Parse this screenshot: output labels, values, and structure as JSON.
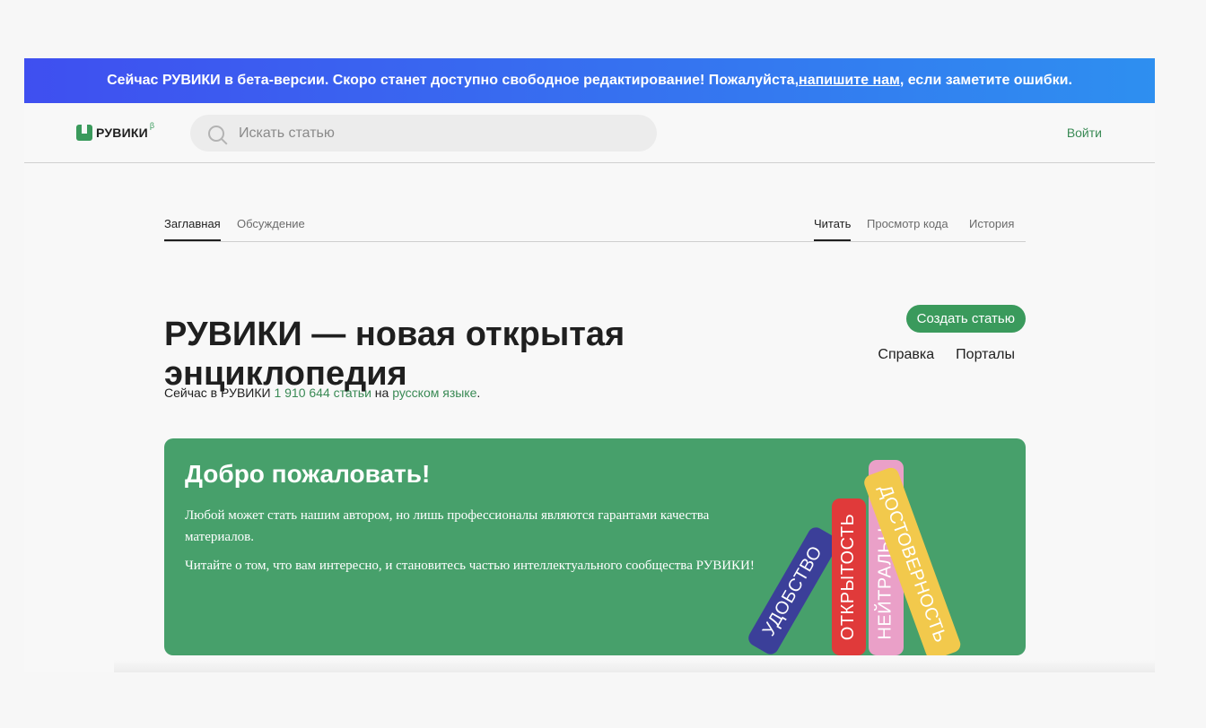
{
  "banner": {
    "text_before": "Сейчас РУВИКИ в бета-версии. Скоро станет доступно свободное редактирование! Пожалуйста, ",
    "link": "напишите нам",
    "text_after": ", если заметите ошибки."
  },
  "header": {
    "logo_text": "РУВИКИ",
    "logo_sup": "β",
    "search_placeholder": "Искать статью",
    "login": "Войти"
  },
  "tabs": {
    "left": [
      "Заглавная",
      "Обсуждение"
    ],
    "right": [
      "Читать",
      "Просмотр кода",
      "История"
    ]
  },
  "main": {
    "title": "РУВИКИ — новая открытая энциклопедия",
    "create_button": "Создать статью",
    "help_link": "Справка",
    "portals_link": "Порталы",
    "stats_prefix": "Сейчас в РУВИКИ ",
    "stats_count": "1 910 644 статьи",
    "stats_mid": " на ",
    "stats_lang": "русском языке",
    "stats_suffix": "."
  },
  "welcome": {
    "heading": "Добро пожаловать!",
    "p1": "Любой может стать нашим автором, но лишь профессионалы являются гарантами качества материалов.",
    "p2": "Читайте о том, что вам интересно, и становитесь частью интеллектуального сообщества РУВИКИ!",
    "books": [
      {
        "label": "УДОБСТВО",
        "color": "#3b3f99"
      },
      {
        "label": "ОТКРЫТОСТЬ",
        "color": "#e03a3a"
      },
      {
        "label": "НЕЙТРАЛЬНОСТЬ",
        "color": "#eaa0c8"
      },
      {
        "label": "ДОСТОВЕРНОСТЬ",
        "color": "#f2c94c"
      }
    ]
  },
  "colors": {
    "accent": "#3a9a5c",
    "banner_start": "#3f4ff0",
    "banner_end": "#2e8ff0"
  }
}
